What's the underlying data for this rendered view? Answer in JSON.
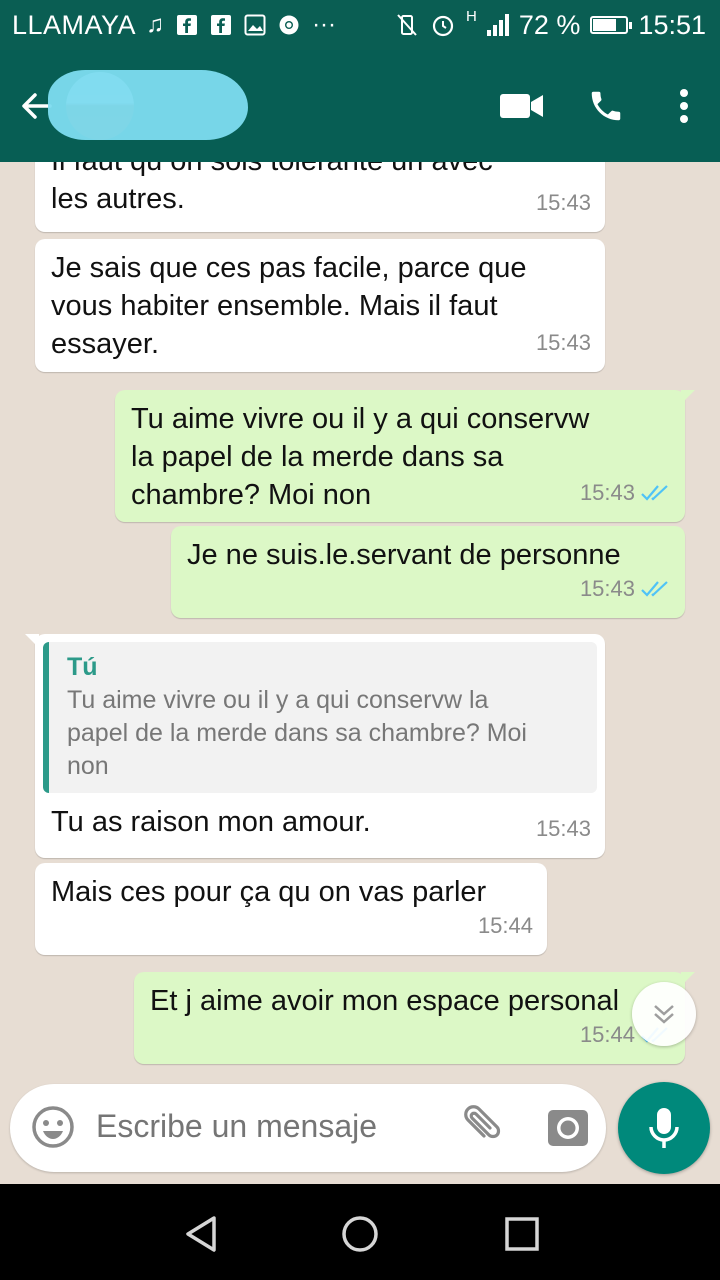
{
  "status_bar": {
    "carrier": "LLAMAYA",
    "network": "H",
    "battery_text": "72 %",
    "battery_level": 0.72,
    "time": "15:51"
  },
  "header": {
    "contact_name": "",
    "icons": [
      "back-arrow-icon",
      "video-call-icon",
      "phone-icon",
      "more-vert-icon"
    ]
  },
  "messages": [
    {
      "direction": "in",
      "text": "Il faut qu on sois tolerante un avec\nles autres.",
      "time": "15:43"
    },
    {
      "direction": "in",
      "text": "Je sais que ces pas facile, parce que\nvous habiter ensemble. Mais il faut\nessayer.",
      "time": "15:43"
    },
    {
      "direction": "out",
      "text": "Tu aime vivre ou il y a qui conservw\nla papel de la merde dans sa\nchambre? Moi non",
      "time": "15:43"
    },
    {
      "direction": "out",
      "text": "Je ne suis.le.servant de personne",
      "time": "15:43"
    },
    {
      "direction": "in",
      "quote_name": "Tú",
      "quote_text": "Tu aime vivre ou il y a qui conservw la\npapel de la merde dans sa chambre? Moi\nnon",
      "text": "Tu as raison mon amour.",
      "time": "15:43"
    },
    {
      "direction": "in",
      "text": "Mais ces pour ça qu on vas parler",
      "time": "15:44"
    },
    {
      "direction": "out",
      "text": "Et j aime avoir mon espace personal",
      "time": "15:44"
    }
  ],
  "composer": {
    "placeholder": "Escribe un mensaje"
  },
  "colors": {
    "header": "#075e54",
    "outgoing_bubble": "#dcf8c6",
    "incoming_bubble": "#ffffff",
    "read_ticks": "#4fc3f7",
    "mic_button": "#00897b"
  }
}
